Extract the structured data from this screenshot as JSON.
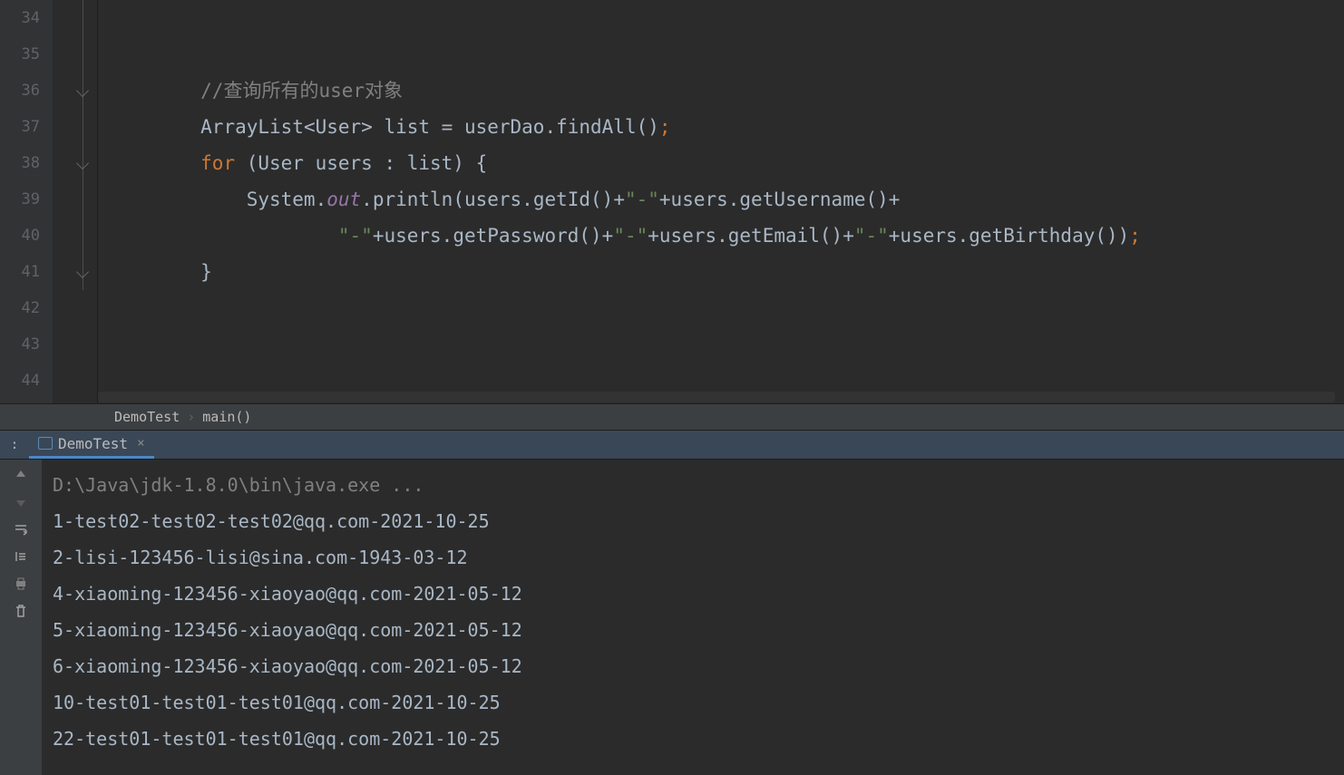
{
  "gutter": {
    "lines": [
      "34",
      "35",
      "36",
      "37",
      "38",
      "39",
      "40",
      "41",
      "42",
      "43",
      "44"
    ]
  },
  "code": {
    "line36_comment": "//查询所有的user对象",
    "line37": {
      "a": "ArrayList<User> list = userDao.findAll()",
      "semi": ";"
    },
    "line38": {
      "kw": "for",
      "rest": " (User users : list) {"
    },
    "line39": {
      "a": "System.",
      "out": "out",
      "b": ".println(users.getId()+",
      "s1": "\"-\"",
      "c": "+users.getUsername()+"
    },
    "line40": {
      "s1": "\"-\"",
      "a": "+users.getPassword()+",
      "s2": "\"-\"",
      "b": "+users.getEmail()+",
      "s3": "\"-\"",
      "c": "+users.getBirthday())",
      "semi": ";"
    },
    "line41": "}"
  },
  "breadcrumb": {
    "item1": "DemoTest",
    "item2": "main()"
  },
  "run_tab": {
    "prefix": ":",
    "label": "DemoTest"
  },
  "console": {
    "cmd": "D:\\Java\\jdk-1.8.0\\bin\\java.exe ...",
    "lines": [
      "1-test02-test02-test02@qq.com-2021-10-25",
      "2-lisi-123456-lisi@sina.com-1943-03-12",
      "4-xiaoming-123456-xiaoyao@qq.com-2021-05-12",
      "5-xiaoming-123456-xiaoyao@qq.com-2021-05-12",
      "6-xiaoming-123456-xiaoyao@qq.com-2021-05-12",
      "10-test01-test01-test01@qq.com-2021-10-25",
      "22-test01-test01-test01@qq.com-2021-10-25"
    ]
  }
}
